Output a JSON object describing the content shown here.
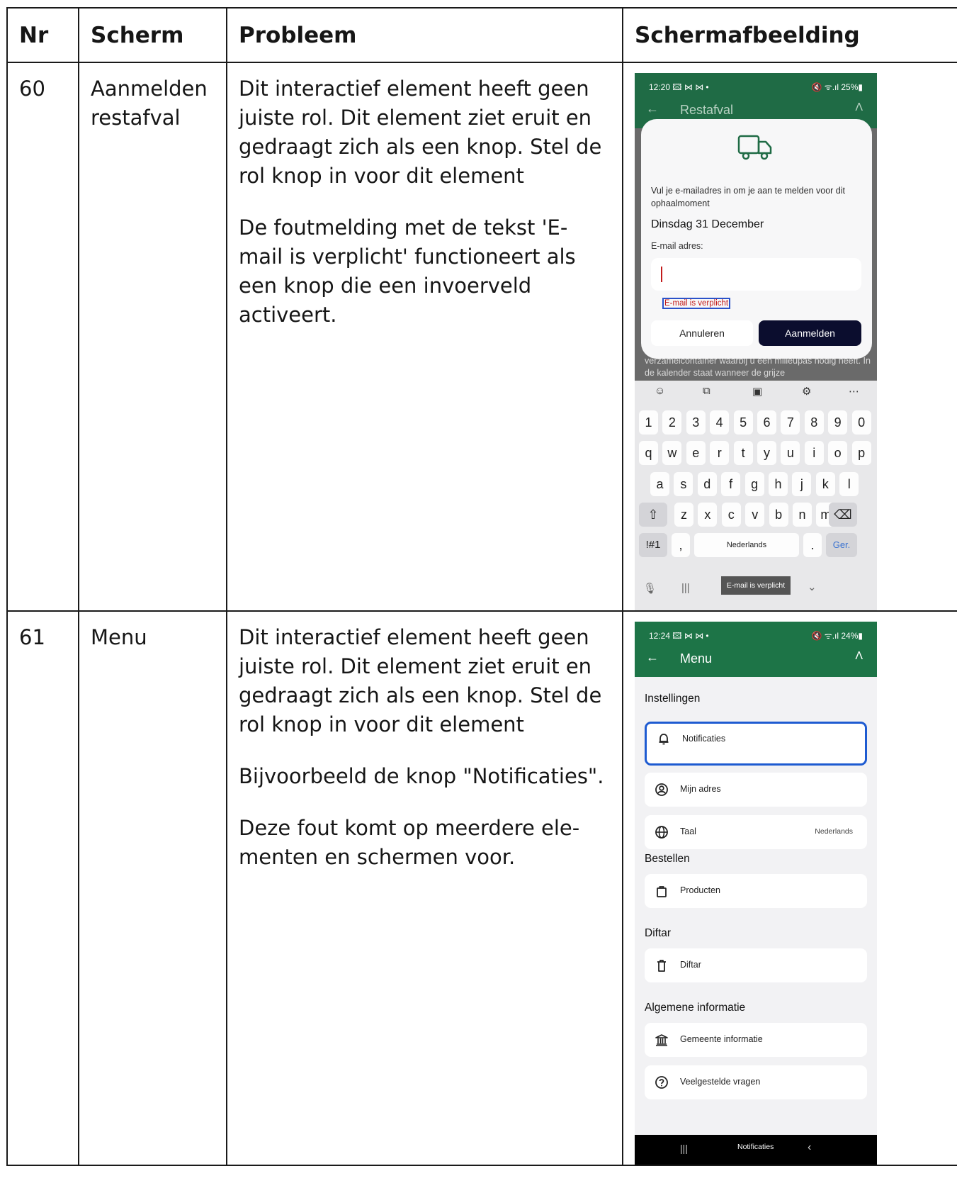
{
  "table": {
    "headers": {
      "nr": "Nr",
      "scherm": "Scherm",
      "probleem": "Probleem",
      "schermafbeelding": "Schermafbeelding"
    },
    "rows": [
      {
        "nr": "60",
        "scherm": "Aanmelden restafval",
        "probleem": [
          "Dit interactief element heeft geen juiste rol. Dit element ziet eruit en gedraagt zich als een knop. Stel de rol knop in voor dit element",
          "De foutmelding met de tekst 'E-mail is verplicht' functioneert als een knop die een invoerveld activeert."
        ]
      },
      {
        "nr": "61",
        "scherm": "Menu",
        "probleem": [
          "Dit interactief element heeft geen juiste rol. Dit element ziet eruit en gedraagt zich als een knop. Stel de rol knop in voor dit element",
          "Bijvoorbeeld de knop \"Notificaties\".",
          "Deze fout komt op meerdere ele- menten en schermen voor."
        ]
      }
    ]
  },
  "phone1": {
    "status": {
      "time": "12:20 🖾 ⋈ ⋈ •",
      "right": "🔇 ᯤ.ıl 25%▮"
    },
    "appbar": {
      "title": "Restafval"
    },
    "dialog": {
      "description": "Vul je e-mailadres in om je aan te melden voor dit ophaalmoment",
      "date": "Dinsdag 31 December",
      "field_label": "E-mail adres:",
      "error": "E-mail is verplicht",
      "cancel": "Annuleren",
      "submit": "Aanmelden"
    },
    "background_text": "verzamelcontainer waarbij u een milieupas nodig heeft. In de kalender staat wanneer de grijze",
    "keyboard": {
      "row_numbers": [
        "1",
        "2",
        "3",
        "4",
        "5",
        "6",
        "7",
        "8",
        "9",
        "0"
      ],
      "row_q": [
        "q",
        "w",
        "e",
        "r",
        "t",
        "y",
        "u",
        "i",
        "o",
        "p"
      ],
      "row_a": [
        "a",
        "s",
        "d",
        "f",
        "g",
        "h",
        "j",
        "k",
        "l"
      ],
      "row_z": [
        "z",
        "x",
        "c",
        "v",
        "b",
        "n",
        "m"
      ],
      "symbols": "!#1",
      "comma": ",",
      "space": "Nederlands",
      "period": ".",
      "go": "Ger."
    },
    "toast": "E-mail is verplicht"
  },
  "phone2": {
    "status": {
      "time": "12:24 🖾 ⋈ ⋈ •",
      "right": "🔇 ᯤ.ıl 24%▮"
    },
    "appbar": {
      "title": "Menu"
    },
    "sections": {
      "instellingen": "Instellingen",
      "bestellen": "Bestellen",
      "diftar": "Diftar",
      "algemeen": "Algemene informatie"
    },
    "items": {
      "notificaties": "Notificaties",
      "mijn_adres": "Mijn adres",
      "taal": "Taal",
      "taal_value": "Nederlands",
      "producten": "Producten",
      "diftar": "Diftar",
      "gemeente": "Gemeente informatie",
      "vragen": "Veelgestelde vragen"
    },
    "toast": "Notificaties"
  }
}
